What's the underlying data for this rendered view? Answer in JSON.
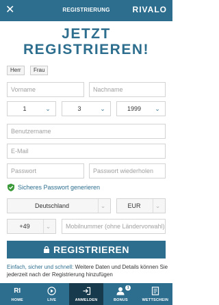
{
  "header": {
    "title": "REGISTRIERUNG",
    "logo": "RIVALO",
    "close_icon": "close-icon"
  },
  "heading": {
    "line1": "JETZT",
    "line2": "REGISTRIEREN!"
  },
  "gender": {
    "options": [
      "Herr",
      "Frau"
    ]
  },
  "form": {
    "firstname_placeholder": "Vorname",
    "lastname_placeholder": "Nachname",
    "birth_day": "1",
    "birth_month": "3",
    "birth_year": "1999",
    "username_placeholder": "Benutzername",
    "email_placeholder": "E-Mail",
    "password_placeholder": "Passwort",
    "password_repeat_placeholder": "Passwort wiederholen",
    "generate_password": "Sicheres Passwort generieren",
    "country": "Deutschland",
    "currency": "EUR",
    "phone_prefix": "+49",
    "mobile_placeholder": "Mobilnummer (ohne Ländervorwahl)"
  },
  "submit": {
    "label": "REGISTRIEREN"
  },
  "note": {
    "emphasis": "Einfach, sicher und schnell:",
    "text": " Weitere Daten und Details können Sie jederzeit nach der Registrierung hinzufügen"
  },
  "tabbar": {
    "items": [
      {
        "label": "HOME",
        "icon": "RI"
      },
      {
        "label": "LIVE",
        "icon": "play-icon"
      },
      {
        "label": "ANMELDEN",
        "icon": "login-icon"
      },
      {
        "label": "BONUS",
        "icon": "user-icon"
      },
      {
        "label": "WETTSCHEIN",
        "icon": "ticket-icon"
      }
    ],
    "bonus_badge": "1"
  },
  "colors": {
    "brand": "#2d6e8e",
    "active_tab": "#173a4d",
    "shield": "#3a9a3a"
  }
}
